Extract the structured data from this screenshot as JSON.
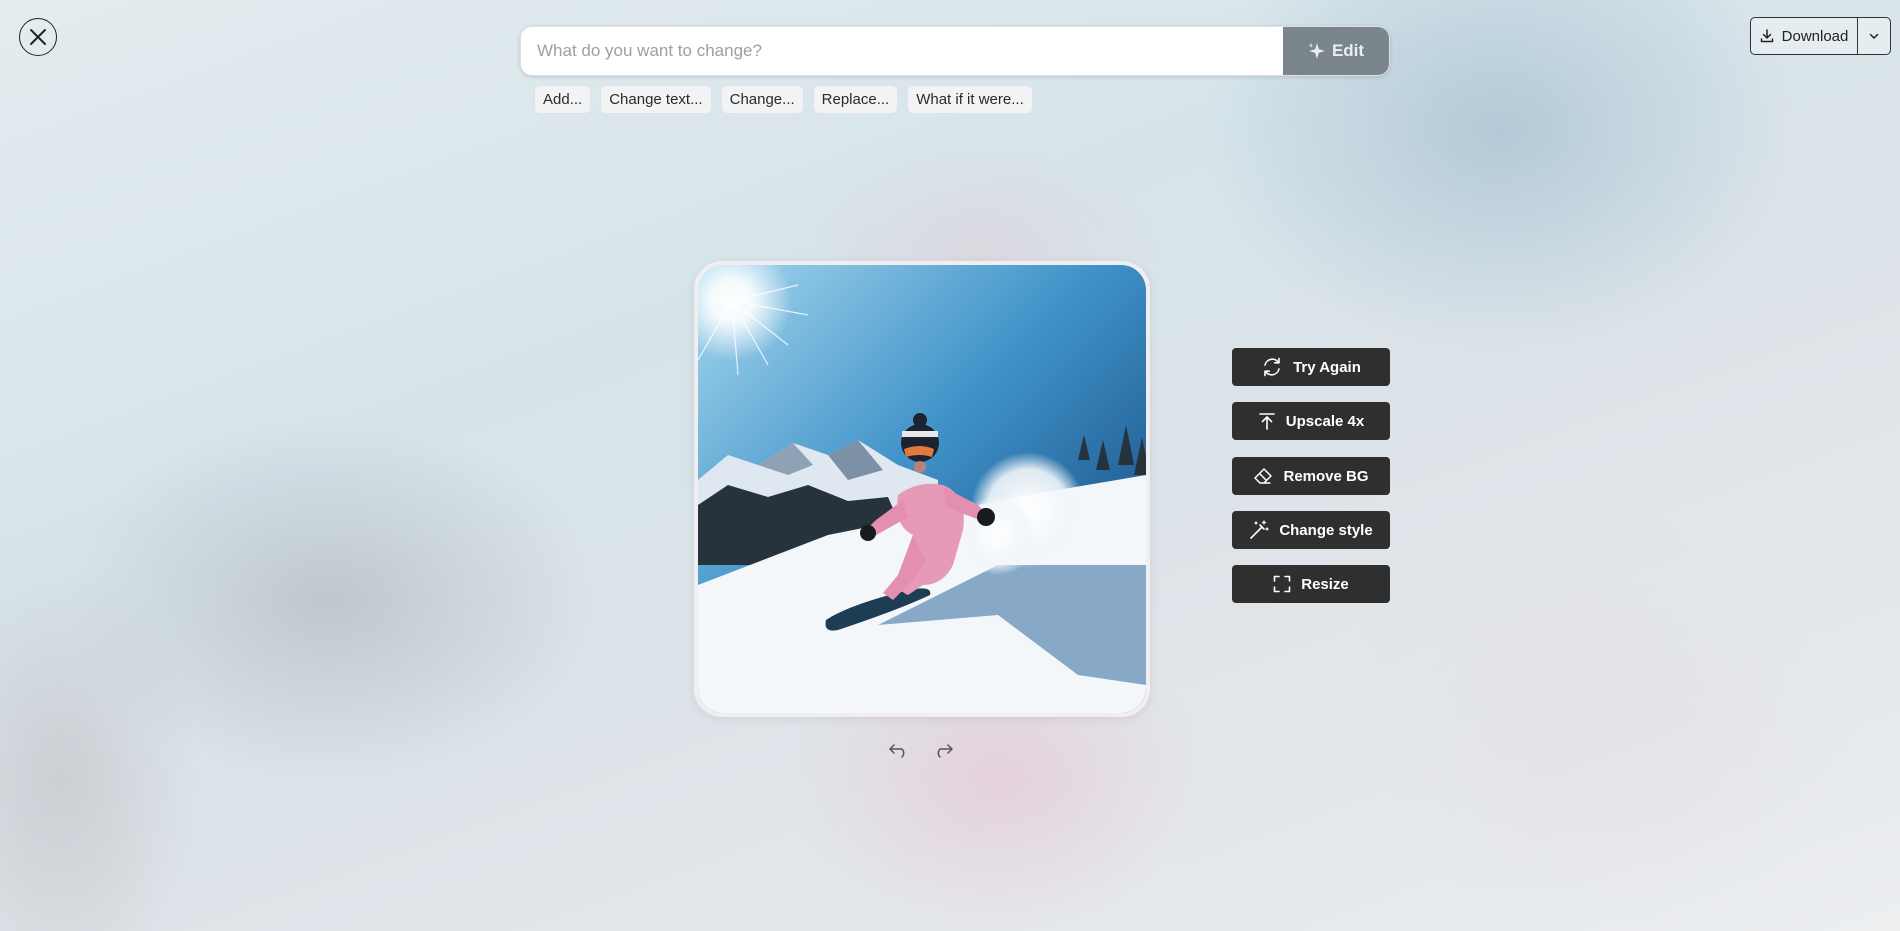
{
  "search": {
    "placeholder": "What do you want to change?",
    "edit_label": "Edit"
  },
  "chips": [
    "Add...",
    "Change text...",
    "Change...",
    "Replace...",
    "What if it were..."
  ],
  "download": {
    "label": "Download"
  },
  "actions": {
    "try_again": "Try Again",
    "upscale": "Upscale 4x",
    "remove_bg": "Remove BG",
    "change_style": "Change style",
    "resize": "Resize"
  },
  "icons": {
    "close": "close-icon",
    "edit": "sparkle-icon",
    "download": "download-icon",
    "caret": "chevron-down-icon",
    "try_again": "refresh-icon",
    "upscale": "arrow-up-icon",
    "remove_bg": "eraser-icon",
    "change_style": "magic-wand-icon",
    "resize": "crop-frame-icon",
    "undo": "undo-icon",
    "redo": "redo-icon"
  },
  "colors": {
    "button_dark": "#2f2f2f",
    "edit_button": "#7b858c",
    "snowsuit": "#e79ab8"
  }
}
